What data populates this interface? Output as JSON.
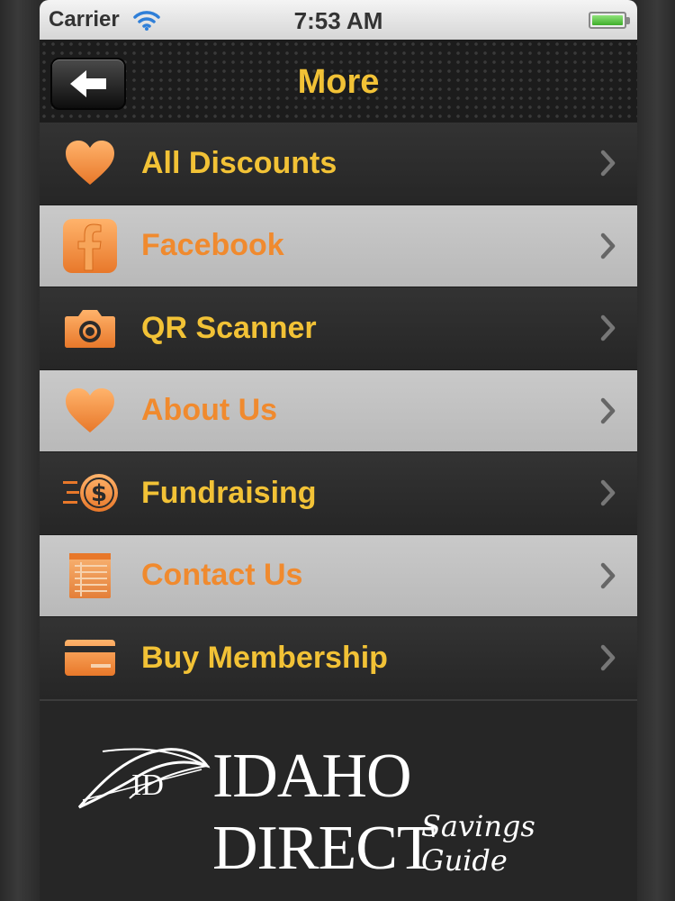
{
  "status_bar": {
    "carrier": "Carrier",
    "time": "7:53 AM"
  },
  "nav": {
    "title": "More",
    "back_icon": "left-arrow-icon"
  },
  "menu": {
    "items": [
      {
        "label": "All Discounts",
        "icon": "heart-icon"
      },
      {
        "label": "Facebook",
        "icon": "facebook-icon"
      },
      {
        "label": "QR Scanner",
        "icon": "camera-icon"
      },
      {
        "label": "About Us",
        "icon": "heart-icon"
      },
      {
        "label": "Fundraising",
        "icon": "dollar-coin-icon"
      },
      {
        "label": "Contact Us",
        "icon": "notepad-icon"
      },
      {
        "label": "Buy Membership",
        "icon": "membership-card-icon"
      }
    ]
  },
  "footer": {
    "logo_main": "IDAHO DIRECT",
    "logo_sub": "Savings Guide",
    "logo_mark": "ID"
  },
  "colors": {
    "accent_yellow": "#f2c236",
    "accent_orange": "#f08a2e"
  }
}
